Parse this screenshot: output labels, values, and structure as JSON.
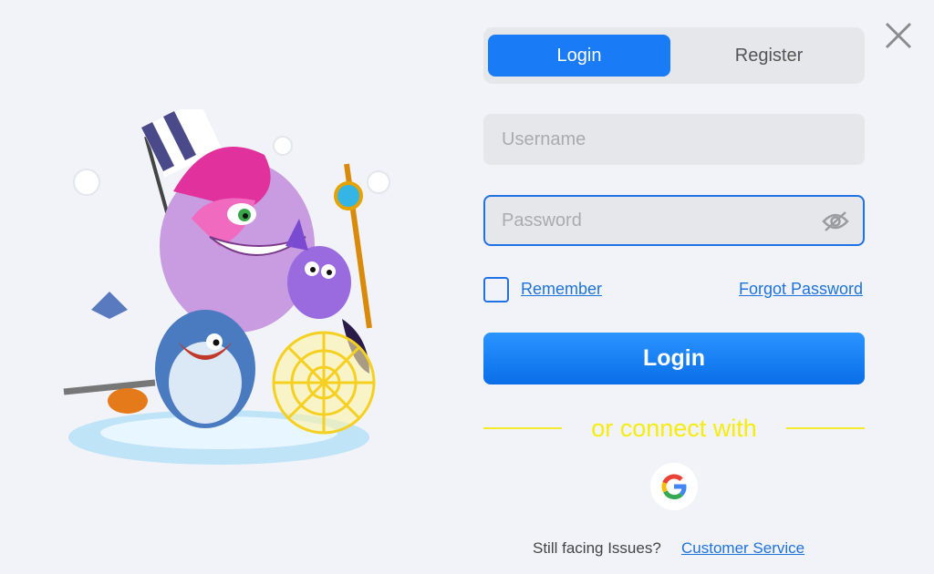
{
  "tabs": {
    "login_label": "Login",
    "register_label": "Register"
  },
  "form": {
    "username_placeholder": "Username",
    "password_placeholder": "Password",
    "remember_label": "Remember",
    "forgot_label": "Forgot Password",
    "submit_label": "Login"
  },
  "social": {
    "divider_text": "or connect with",
    "google_icon": "google-icon"
  },
  "footer": {
    "issue_text": "Still facing Issues?",
    "support_link": "Customer Service"
  },
  "icons": {
    "close": "close-icon",
    "password_visibility": "eye-off-icon"
  },
  "colors": {
    "accent": "#1a7bf7",
    "divider": "#f6ec0e",
    "background": "#f1f3f8"
  }
}
